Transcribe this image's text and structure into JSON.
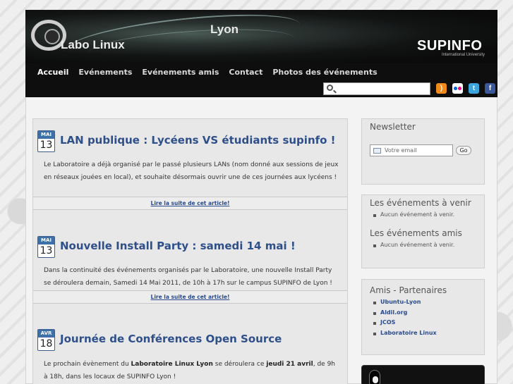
{
  "site": {
    "logo_text": "Labo Linux",
    "city": "Lyon",
    "brand": "SUPINFO",
    "brand_sub": "International University"
  },
  "nav": {
    "items": [
      {
        "label": "Accueil",
        "active": true
      },
      {
        "label": "Evénements"
      },
      {
        "label": "Evénements amis"
      },
      {
        "label": "Contact"
      },
      {
        "label": "Photos des événements"
      }
    ]
  },
  "search": {
    "value": "",
    "placeholder": ""
  },
  "social": [
    "rss-icon",
    "flickr-icon",
    "twitter-icon",
    "facebook-icon"
  ],
  "articles": [
    {
      "month": "MAI",
      "day": "13",
      "title": "LAN publique : Lycéens VS étudiants supinfo !",
      "body": "Le Laboratoire a déjà organisé par le passé plusieurs LANs (nom donné aux sessions de jeux en réseaux jouées en local), et souhaite désormais ouvrir une de ces journées aux lycéens !",
      "more": "Lire la suite de cet article!"
    },
    {
      "month": "MAI",
      "day": "13",
      "title": "Nouvelle Install Party : samedi 14 mai !",
      "body": "Dans la continuité des événements organisés par le Laboratoire, une nouvelle Install Party se déroulera demain, Samedi 14 Mai 2011, de 10h à 17h sur le campus SUPINFO de Lyon !",
      "more": "Lire la suite de cet article!"
    },
    {
      "month": "AVR",
      "day": "18",
      "title": "Journée de Conférences Open Source",
      "body_parts": [
        "Le prochain évènement du ",
        "Laboratoire Linux Lyon",
        " se déroulera ce ",
        "jeudi 21 avril",
        ", de 9h à 18h, dans les locaux de SUPINFO Lyon !"
      ]
    }
  ],
  "newsletter": {
    "title": "Newsletter",
    "placeholder": "Votre email",
    "button": "Go"
  },
  "events": {
    "title": "Les événements à venir",
    "empty": "Aucun événement à venir."
  },
  "friend_events": {
    "title": "Les événements amis",
    "empty": "Aucun événement à venir."
  },
  "partners": {
    "title": "Amis - Partenaires",
    "items": [
      "Ubuntu-Lyon",
      "Aldil.org",
      "JCOS",
      "Laboratoire Linux"
    ]
  },
  "colors": {
    "title_blue": "#2e4f8a",
    "calendar_blue": "#3d6fa8",
    "header_bg": "#0e0e0e"
  }
}
